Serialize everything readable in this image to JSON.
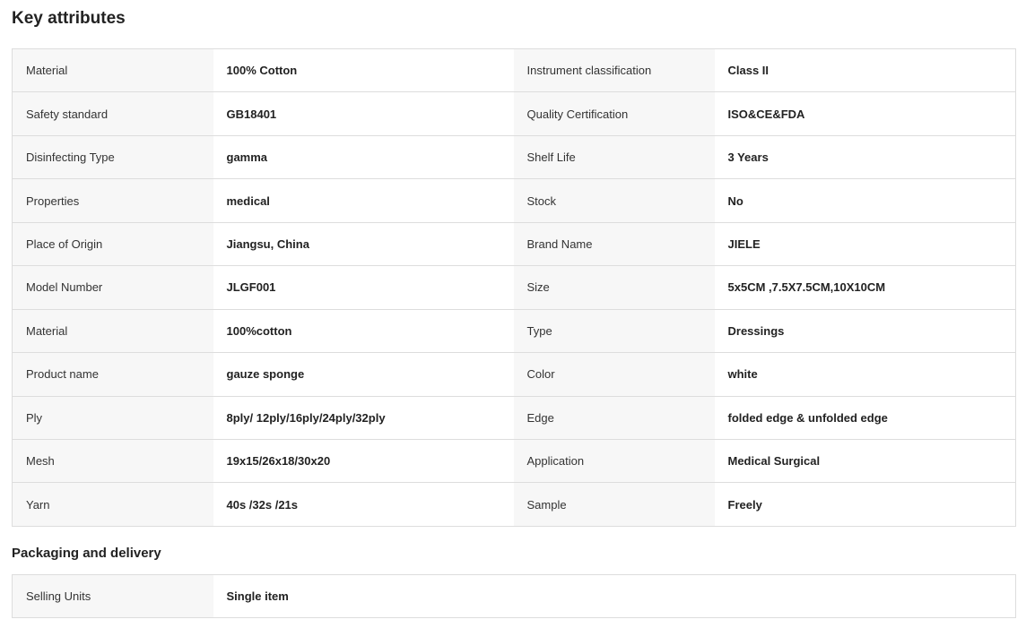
{
  "key_attributes": {
    "title": "Key attributes",
    "rows": [
      [
        {
          "label": "Material",
          "value": "100% Cotton"
        },
        {
          "label": "Instrument classification",
          "value": "Class II"
        }
      ],
      [
        {
          "label": "Safety standard",
          "value": "GB18401"
        },
        {
          "label": "Quality Certification",
          "value": "ISO&CE&FDA"
        }
      ],
      [
        {
          "label": "Disinfecting Type",
          "value": "gamma"
        },
        {
          "label": "Shelf Life",
          "value": "3 Years"
        }
      ],
      [
        {
          "label": "Properties",
          "value": "medical"
        },
        {
          "label": "Stock",
          "value": "No"
        }
      ],
      [
        {
          "label": "Place of Origin",
          "value": "Jiangsu, China"
        },
        {
          "label": "Brand Name",
          "value": "JIELE"
        }
      ],
      [
        {
          "label": "Model Number",
          "value": "JLGF001"
        },
        {
          "label": "Size",
          "value": "5x5CM ,7.5X7.5CM,10X10CM"
        }
      ],
      [
        {
          "label": "Material",
          "value": "100%cotton"
        },
        {
          "label": "Type",
          "value": "Dressings"
        }
      ],
      [
        {
          "label": "Product name",
          "value": "gauze sponge"
        },
        {
          "label": "Color",
          "value": "white"
        }
      ],
      [
        {
          "label": "Ply",
          "value": "8ply/ 12ply/16ply/24ply/32ply"
        },
        {
          "label": "Edge",
          "value": "folded edge & unfolded edge"
        }
      ],
      [
        {
          "label": "Mesh",
          "value": "19x15/26x18/30x20"
        },
        {
          "label": "Application",
          "value": "Medical Surgical"
        }
      ],
      [
        {
          "label": "Yarn",
          "value": "40s /32s /21s"
        },
        {
          "label": "Sample",
          "value": "Freely"
        }
      ]
    ]
  },
  "packaging": {
    "title": "Packaging and delivery",
    "rows": [
      {
        "label": "Selling Units",
        "value": "Single item"
      }
    ]
  },
  "colors": {
    "label_cell_bg": "#f7f7f7",
    "border": "#dddddd",
    "text": "#222222"
  }
}
